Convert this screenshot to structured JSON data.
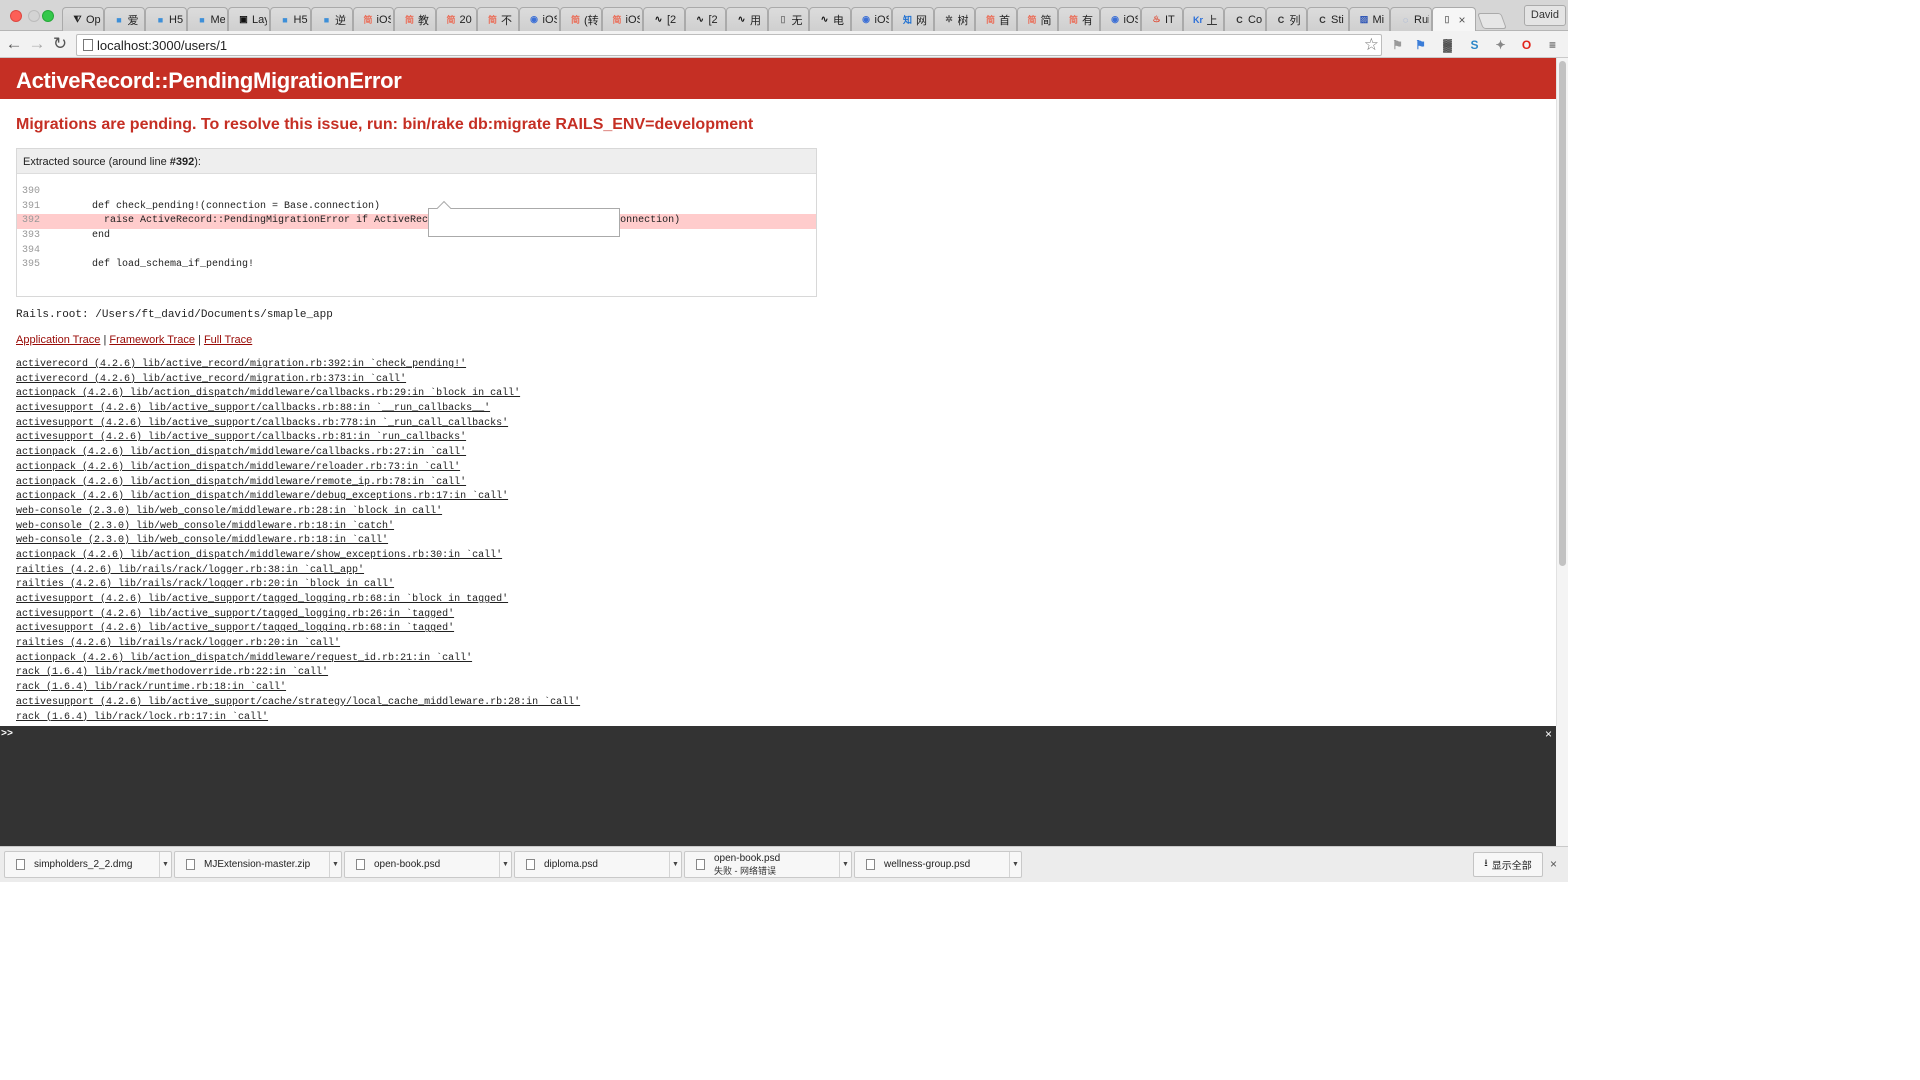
{
  "browser": {
    "tabs": [
      {
        "title": "Op",
        "icon": "filter-icon",
        "color": "#222222"
      },
      {
        "title": "爱",
        "icon": "site-icon",
        "color": "#3d8fd8"
      },
      {
        "title": "H5",
        "icon": "site-icon",
        "color": "#3d8fd8"
      },
      {
        "title": "Me",
        "icon": "site-icon",
        "color": "#3d8fd8"
      },
      {
        "title": "Lay",
        "icon": "github-icon",
        "color": "#111111"
      },
      {
        "title": "H5",
        "icon": "site-icon",
        "color": "#3d8fd8"
      },
      {
        "title": "逆",
        "icon": "site-icon",
        "color": "#3d8fd8"
      },
      {
        "title": "iOS",
        "icon": "jianshu-icon",
        "color": "#ea6f5a"
      },
      {
        "title": "教",
        "icon": "jianshu-icon",
        "color": "#ea6f5a"
      },
      {
        "title": "20",
        "icon": "jianshu-icon",
        "color": "#ea6f5a"
      },
      {
        "title": "不",
        "icon": "jianshu-icon",
        "color": "#ea6f5a"
      },
      {
        "title": "iOS",
        "icon": "cocoachina-icon",
        "color": "#3b6fd6"
      },
      {
        "title": "(转",
        "icon": "jianshu-icon",
        "color": "#ea6f5a"
      },
      {
        "title": "iOS",
        "icon": "jianshu-icon",
        "color": "#ea6f5a"
      },
      {
        "title": "[2",
        "icon": "pulse-icon",
        "color": "#111111"
      },
      {
        "title": "[2",
        "icon": "pulse-icon",
        "color": "#111111"
      },
      {
        "title": "用",
        "icon": "pulse-icon",
        "color": "#111111"
      },
      {
        "title": "无",
        "icon": "page-icon",
        "color": "#777777"
      },
      {
        "title": "电",
        "icon": "pulse-icon",
        "color": "#111111"
      },
      {
        "title": "iOS",
        "icon": "cocoachina-icon",
        "color": "#3b6fd6"
      },
      {
        "title": "网",
        "icon": "zhihu-icon",
        "color": "#1e70d2"
      },
      {
        "title": "树",
        "icon": "tree-icon",
        "color": "#555555"
      },
      {
        "title": "首",
        "icon": "jianshu-icon",
        "color": "#ea6f5a"
      },
      {
        "title": "简",
        "icon": "jianshu-icon",
        "color": "#ea6f5a"
      },
      {
        "title": "有",
        "icon": "jianshu-icon",
        "color": "#ea6f5a"
      },
      {
        "title": "iOS",
        "icon": "cocoachina-icon",
        "color": "#3b6fd6"
      },
      {
        "title": "IT",
        "icon": "flame-icon",
        "color": "#e0442c"
      },
      {
        "title": "上",
        "icon": "kr-icon",
        "color": "#2b6fd8"
      },
      {
        "title": "Co",
        "icon": "c-icon",
        "color": "#333333"
      },
      {
        "title": "列",
        "icon": "c-icon",
        "color": "#333333"
      },
      {
        "title": "Sti",
        "icon": "c-icon",
        "color": "#333333"
      },
      {
        "title": "Mi",
        "icon": "image-icon",
        "color": "#2b53b5"
      },
      {
        "title": "Rui",
        "icon": "loading-icon",
        "color": "#6a8fd8"
      }
    ],
    "active_tab": {
      "title": "",
      "icon": "page-icon"
    },
    "profile_name": "David",
    "url": "localhost:3000/users/1",
    "extensions": [
      "translate-icon",
      "translate-blue-icon",
      "qr-code-icon",
      "s-icon",
      "puzzle-icon",
      "opera-icon"
    ]
  },
  "page": {
    "exception": "ActiveRecord::PendingMigrationError",
    "message": "Migrations are pending. To resolve this issue, run: bin/rake db:migrate RAILS_ENV=development",
    "source_label_prefix": "Extracted source (around line ",
    "source_label_line": "#392",
    "source_label_suffix": "):",
    "source_lines": [
      {
        "num": "390",
        "code": "",
        "highlight": false
      },
      {
        "num": "391",
        "code": "      def check_pending!(connection = Base.connection)",
        "highlight": false
      },
      {
        "num": "392",
        "code": "        raise ActiveRecord::PendingMigrationError if ActiveRecord::Migrator.needs_migration?(connection)",
        "highlight": true
      },
      {
        "num": "393",
        "code": "      end",
        "highlight": false
      },
      {
        "num": "394",
        "code": "",
        "highlight": false
      },
      {
        "num": "395",
        "code": "      def load_schema_if_pending!",
        "highlight": false
      }
    ],
    "rails_root": "Rails.root: /Users/ft_david/Documents/smaple_app",
    "trace_tabs": [
      "Application Trace",
      "Framework Trace",
      "Full Trace"
    ],
    "trace_separator": " | ",
    "trace": [
      "activerecord (4.2.6) lib/active_record/migration.rb:392:in `check_pending!'",
      "activerecord (4.2.6) lib/active_record/migration.rb:373:in `call'",
      "actionpack (4.2.6) lib/action_dispatch/middleware/callbacks.rb:29:in `block in call'",
      "activesupport (4.2.6) lib/active_support/callbacks.rb:88:in `__run_callbacks__'",
      "activesupport (4.2.6) lib/active_support/callbacks.rb:778:in `_run_call_callbacks'",
      "activesupport (4.2.6) lib/active_support/callbacks.rb:81:in `run_callbacks'",
      "actionpack (4.2.6) lib/action_dispatch/middleware/callbacks.rb:27:in `call'",
      "actionpack (4.2.6) lib/action_dispatch/middleware/reloader.rb:73:in `call'",
      "actionpack (4.2.6) lib/action_dispatch/middleware/remote_ip.rb:78:in `call'",
      "actionpack (4.2.6) lib/action_dispatch/middleware/debug_exceptions.rb:17:in `call'",
      "web-console (2.3.0) lib/web_console/middleware.rb:28:in `block in call'",
      "web-console (2.3.0) lib/web_console/middleware.rb:18:in `catch'",
      "web-console (2.3.0) lib/web_console/middleware.rb:18:in `call'",
      "actionpack (4.2.6) lib/action_dispatch/middleware/show_exceptions.rb:30:in `call'",
      "railties (4.2.6) lib/rails/rack/logger.rb:38:in `call_app'",
      "railties (4.2.6) lib/rails/rack/logger.rb:20:in `block in call'",
      "activesupport (4.2.6) lib/active_support/tagged_logging.rb:68:in `block in tagged'",
      "activesupport (4.2.6) lib/active_support/tagged_logging.rb:26:in `tagged'",
      "activesupport (4.2.6) lib/active_support/tagged_logging.rb:68:in `tagged'",
      "railties (4.2.6) lib/rails/rack/logger.rb:20:in `call'",
      "actionpack (4.2.6) lib/action_dispatch/middleware/request_id.rb:21:in `call'",
      "rack (1.6.4) lib/rack/methodoverride.rb:22:in `call'",
      "rack (1.6.4) lib/rack/runtime.rb:18:in `call'",
      "activesupport (4.2.6) lib/active_support/cache/strategy/local_cache_middleware.rb:28:in `call'",
      "rack (1.6.4) lib/rack/lock.rb:17:in `call'"
    ]
  },
  "console": {
    "prompt": ">>",
    "close": "×"
  },
  "downloads": {
    "items": [
      {
        "name": "simpholders_2_2.dmg",
        "status": ""
      },
      {
        "name": "MJExtension-master.zip",
        "status": ""
      },
      {
        "name": "open-book.psd",
        "status": ""
      },
      {
        "name": "diploma.psd",
        "status": ""
      },
      {
        "name": "open-book.psd",
        "status": "失败 - 网络错误"
      },
      {
        "name": "wellness-group.psd",
        "status": ""
      }
    ],
    "show_all": "显示全部",
    "close": "×"
  },
  "colors": {
    "error_red": "#c52f24",
    "trace_link": "#980905",
    "highlight_line": "#ffcccc",
    "console_bg": "#333333"
  }
}
